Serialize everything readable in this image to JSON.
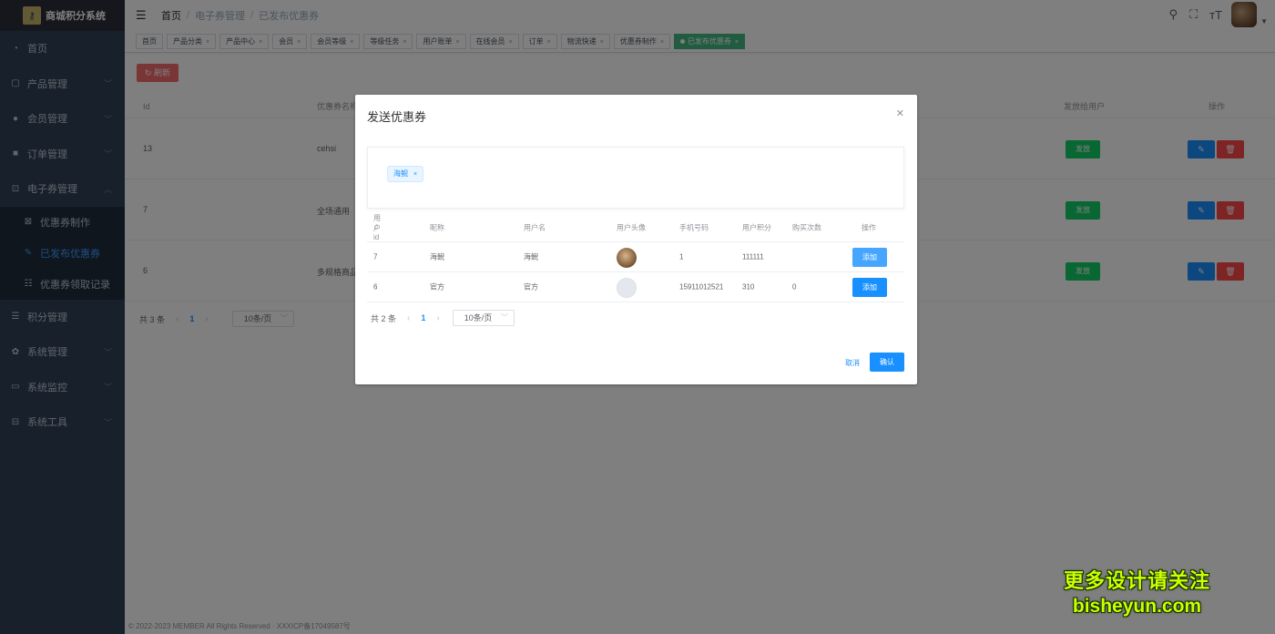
{
  "sidebar": {
    "logo_text": "商城积分系统",
    "items": [
      {
        "label": "首页",
        "icon": "dashboard-icon",
        "has_children": false
      },
      {
        "label": "产品管理",
        "icon": "product-icon",
        "has_children": true
      },
      {
        "label": "会员管理",
        "icon": "user-icon",
        "has_children": true
      },
      {
        "label": "订单管理",
        "icon": "lock-icon",
        "has_children": true
      },
      {
        "label": "电子券管理",
        "icon": "coupon-icon",
        "has_children": true,
        "expanded": true
      }
    ],
    "subitems": [
      {
        "label": "优惠券制作",
        "icon": "doc-icon"
      },
      {
        "label": "已发布优惠券",
        "icon": "edit-icon",
        "active": true
      },
      {
        "label": "优惠券领取记录",
        "icon": "record-icon"
      }
    ],
    "items_after": [
      {
        "label": "积分管理",
        "icon": "list-icon"
      },
      {
        "label": "系统管理",
        "icon": "gear-icon"
      },
      {
        "label": "系统监控",
        "icon": "monitor-icon"
      },
      {
        "label": "系统工具",
        "icon": "tool-icon"
      }
    ]
  },
  "breadcrumb": [
    "首页",
    "电子券管理",
    "已发布优惠券"
  ],
  "tags": [
    "首页",
    "产品分类",
    "产品中心",
    "会员",
    "会员等级",
    "等级任务",
    "用户账单",
    "在线会员",
    "订单",
    "物流快递",
    "优惠券制作",
    "已发布优惠券"
  ],
  "toolbar": {
    "refresh_label": "刷新"
  },
  "table": {
    "headers": {
      "id": "Id",
      "name": "优惠券名称",
      "send_user": "发放给用户",
      "ops": "操作"
    },
    "rows": [
      {
        "id": "13",
        "name": "cehsi"
      },
      {
        "id": "7",
        "name": "全场通用"
      },
      {
        "id": "6",
        "name": "多规格商品"
      }
    ],
    "send_label": "发放",
    "edit_icon": "✎",
    "delete_icon": "🗑"
  },
  "pager": {
    "total": "共 3 条",
    "page": "1",
    "size": "10条/页"
  },
  "footer": "© 2022-2023 MEMBER All Rights Reserved · XXXICP备17049587号",
  "dialog": {
    "title": "发送优惠券",
    "chip": "海鲵",
    "headers": [
      "用户id",
      "昵称",
      "用户名",
      "用户头像",
      "手机号码",
      "用户积分",
      "购买次数",
      "操作"
    ],
    "rows": [
      {
        "id": "7",
        "nick": "海鲵",
        "username": "海鲵",
        "phone": "1",
        "points": "111111",
        "buys": "",
        "btn": "添加"
      },
      {
        "id": "6",
        "nick": "官方",
        "username": "官方",
        "phone": "15911012521",
        "points": "310",
        "buys": "0",
        "btn": "添加"
      }
    ],
    "pager": {
      "total": "共 2 条",
      "page": "1",
      "size": "10条/页"
    },
    "cancel": "取消",
    "ok": "确认"
  },
  "watermark": {
    "line1": "更多设计请关注",
    "line2": "bisheyun.com"
  }
}
